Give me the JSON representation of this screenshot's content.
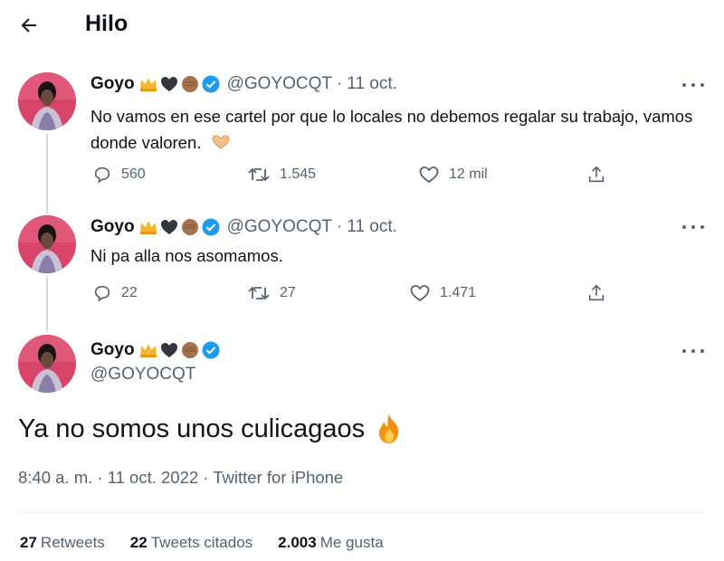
{
  "header": {
    "title": "Hilo"
  },
  "tweets": [
    {
      "name": "Goyo",
      "handle": "@GOYOCQT",
      "sep": "·",
      "date": "11 oct.",
      "text": "No vamos en ese cartel por que lo locales no debemos regalar su trabajo, vamos donde valoren.",
      "replies": "560",
      "retweets": "1.545",
      "likes": "12 mil"
    },
    {
      "name": "Goyo",
      "handle": "@GOYOCQT",
      "sep": "·",
      "date": "11 oct.",
      "text": "Ni pa alla nos asomamos.",
      "replies": "22",
      "retweets": "27",
      "likes": "1.471"
    }
  ],
  "main_tweet": {
    "name": "Goyo",
    "handle": "@GOYOCQT",
    "text": "Ya no somos unos culicagaos",
    "timestamp": "8:40 a. m. · 11 oct. 2022 · Twitter for iPhone",
    "stats": {
      "retweets_count": "27",
      "retweets_label": "Retweets",
      "quotes_count": "22",
      "quotes_label": "Tweets citados",
      "likes_count": "2.003",
      "likes_label": "Me gusta"
    }
  },
  "icons": {
    "name_emojis": [
      "crown-emoji",
      "black-heart-emoji",
      "raised-fist-emoji",
      "verified-badge"
    ],
    "text_emoji": "heart-hands-emoji",
    "main_emoji": "fire-emoji"
  },
  "colors": {
    "text": "#0f1419",
    "secondary": "#536471",
    "verified": "#1d9bf0",
    "line": "#cfd9de"
  }
}
